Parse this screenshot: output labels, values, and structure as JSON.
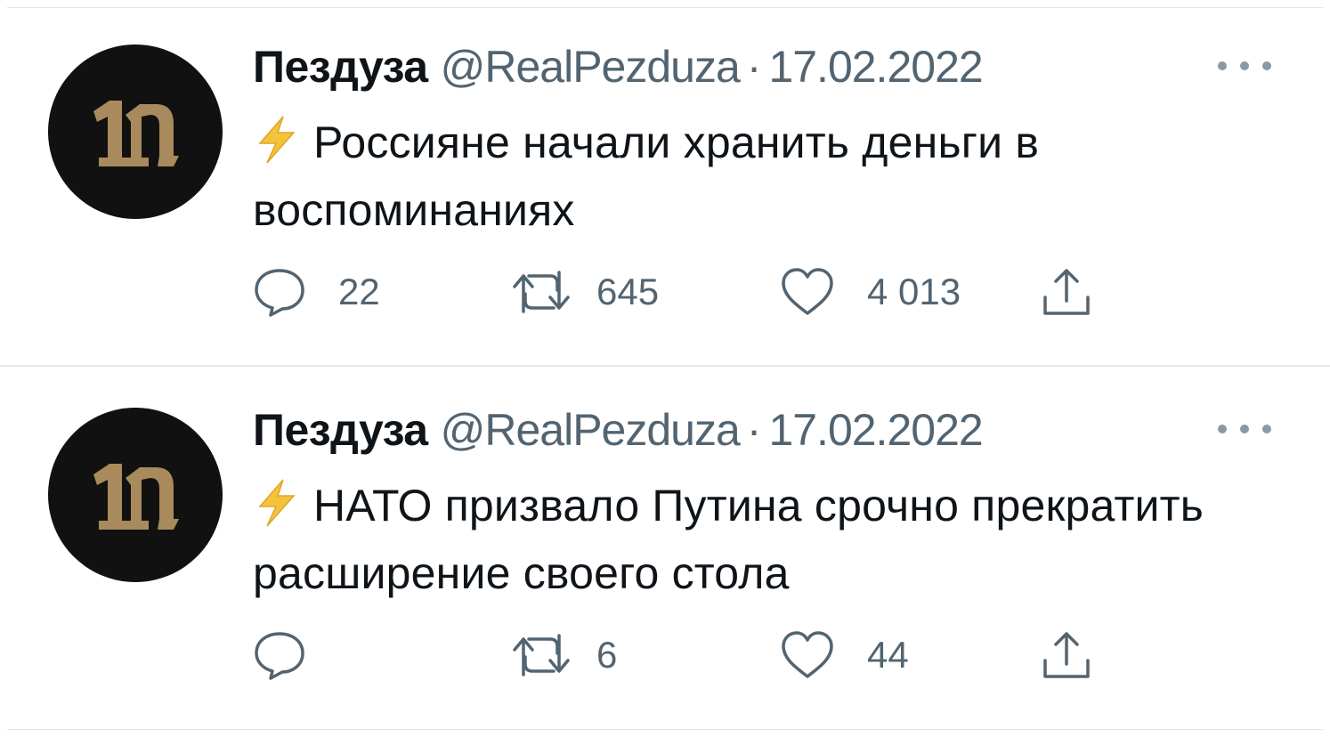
{
  "tweets": [
    {
      "author_name": "Пездуза",
      "handle": "@RealPezduza",
      "separator": "·",
      "date": "17.02.2022",
      "text": "Россияне начали хранить деньги в воспоминаниях",
      "emoji": "lightning-bolt-emoji",
      "replies": "22",
      "retweets": "645",
      "likes": "4 013"
    },
    {
      "author_name": "Пездуза",
      "handle": "@RealPezduza",
      "separator": "·",
      "date": "17.02.2022",
      "text": "НАТО призвало Путина срочно прекратить расширение своего стола",
      "emoji": "lightning-bolt-emoji",
      "replies": "",
      "retweets": "6",
      "likes": "44"
    }
  ],
  "colors": {
    "text_primary": "#0f1419",
    "text_secondary": "#536471",
    "avatar_bg": "#111111",
    "avatar_logo": "#a88a5c",
    "bolt": "#f5c33b",
    "divider": "#e6e8ea"
  },
  "icons": {
    "avatar_logo": "pezduza-logo-icon",
    "reply": "reply-icon",
    "retweet": "retweet-icon",
    "like": "heart-icon",
    "share": "share-icon",
    "more": "more-options-icon"
  }
}
